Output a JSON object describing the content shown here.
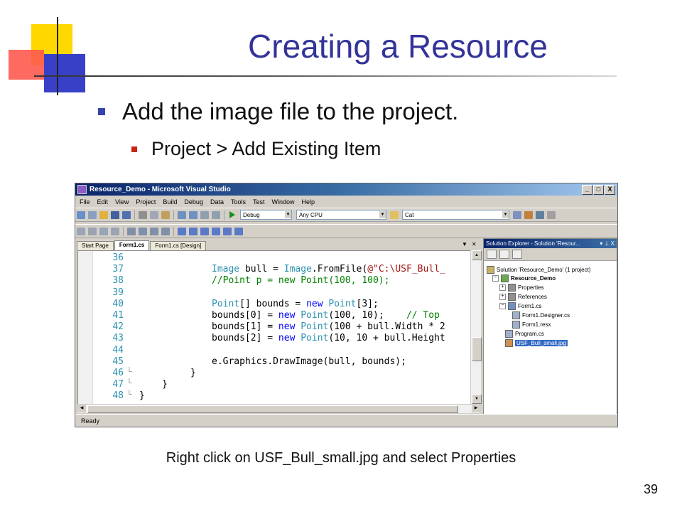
{
  "slide": {
    "title": "Creating a Resource",
    "bullet_1": "Add the image file to the project.",
    "bullet_2": "Project > Add Existing Item",
    "caption": "Right click on USF_Bull_small.jpg and select Properties",
    "page_number": "39"
  },
  "colors": {
    "title": "#333399",
    "bullet_primary": "#3344aa",
    "bullet_secondary": "#cc2211"
  },
  "vs": {
    "window_title": "Resource_Demo - Microsoft Visual Studio",
    "window_buttons": [
      "_",
      "□",
      "X"
    ],
    "menu": [
      "File",
      "Edit",
      "View",
      "Project",
      "Build",
      "Debug",
      "Data",
      "Tools",
      "Test",
      "Window",
      "Help"
    ],
    "config_combo": "Debug",
    "platform_combo": "Any CPU",
    "find_combo": "Cat",
    "tabs": [
      "Start Page",
      "Form1.cs",
      "Form1.cs [Design]"
    ],
    "active_tab": "Form1.cs",
    "code_lines": [
      {
        "num": "36",
        "code": ""
      },
      {
        "num": "37",
        "code": "Image bull = Image.FromFile(@\"C:\\USF_Bull_"
      },
      {
        "num": "38",
        "code": "//Point p = new Point(100, 100);"
      },
      {
        "num": "39",
        "code": ""
      },
      {
        "num": "40",
        "code": "Point[] bounds = new Point[3];"
      },
      {
        "num": "41",
        "code": "bounds[0] = new Point(100, 10);    // Top"
      },
      {
        "num": "42",
        "code": "bounds[1] = new Point(100 + bull.Width * 2"
      },
      {
        "num": "43",
        "code": "bounds[2] = new Point(10, 10 + bull.Height"
      },
      {
        "num": "44",
        "code": ""
      },
      {
        "num": "45",
        "code": "e.Graphics.DrawImage(bull, bounds);"
      },
      {
        "num": "46",
        "code": "}"
      },
      {
        "num": "47",
        "code": "}"
      },
      {
        "num": "48",
        "code": "}"
      }
    ],
    "solution_explorer": {
      "title": "Solution Explorer - Solution 'Resour...",
      "title_buttons": [
        "▾",
        "⊥",
        "X"
      ],
      "items": [
        {
          "label": "Solution 'Resource_Demo' (1 project)",
          "expander": "",
          "bold": false,
          "selected": false
        },
        {
          "label": "Resource_Demo",
          "expander": "−",
          "bold": true,
          "selected": false
        },
        {
          "label": "Properties",
          "expander": "+",
          "bold": false,
          "selected": false
        },
        {
          "label": "References",
          "expander": "+",
          "bold": false,
          "selected": false
        },
        {
          "label": "Form1.cs",
          "expander": "−",
          "bold": false,
          "selected": false
        },
        {
          "label": "Form1.Designer.cs",
          "expander": "",
          "bold": false,
          "selected": false
        },
        {
          "label": "Form1.resx",
          "expander": "",
          "bold": false,
          "selected": false
        },
        {
          "label": "Program.cs",
          "expander": "",
          "bold": false,
          "selected": false
        },
        {
          "label": "USF_Bull_small.jpg",
          "expander": "",
          "bold": false,
          "selected": true
        }
      ]
    },
    "status": "Ready"
  }
}
